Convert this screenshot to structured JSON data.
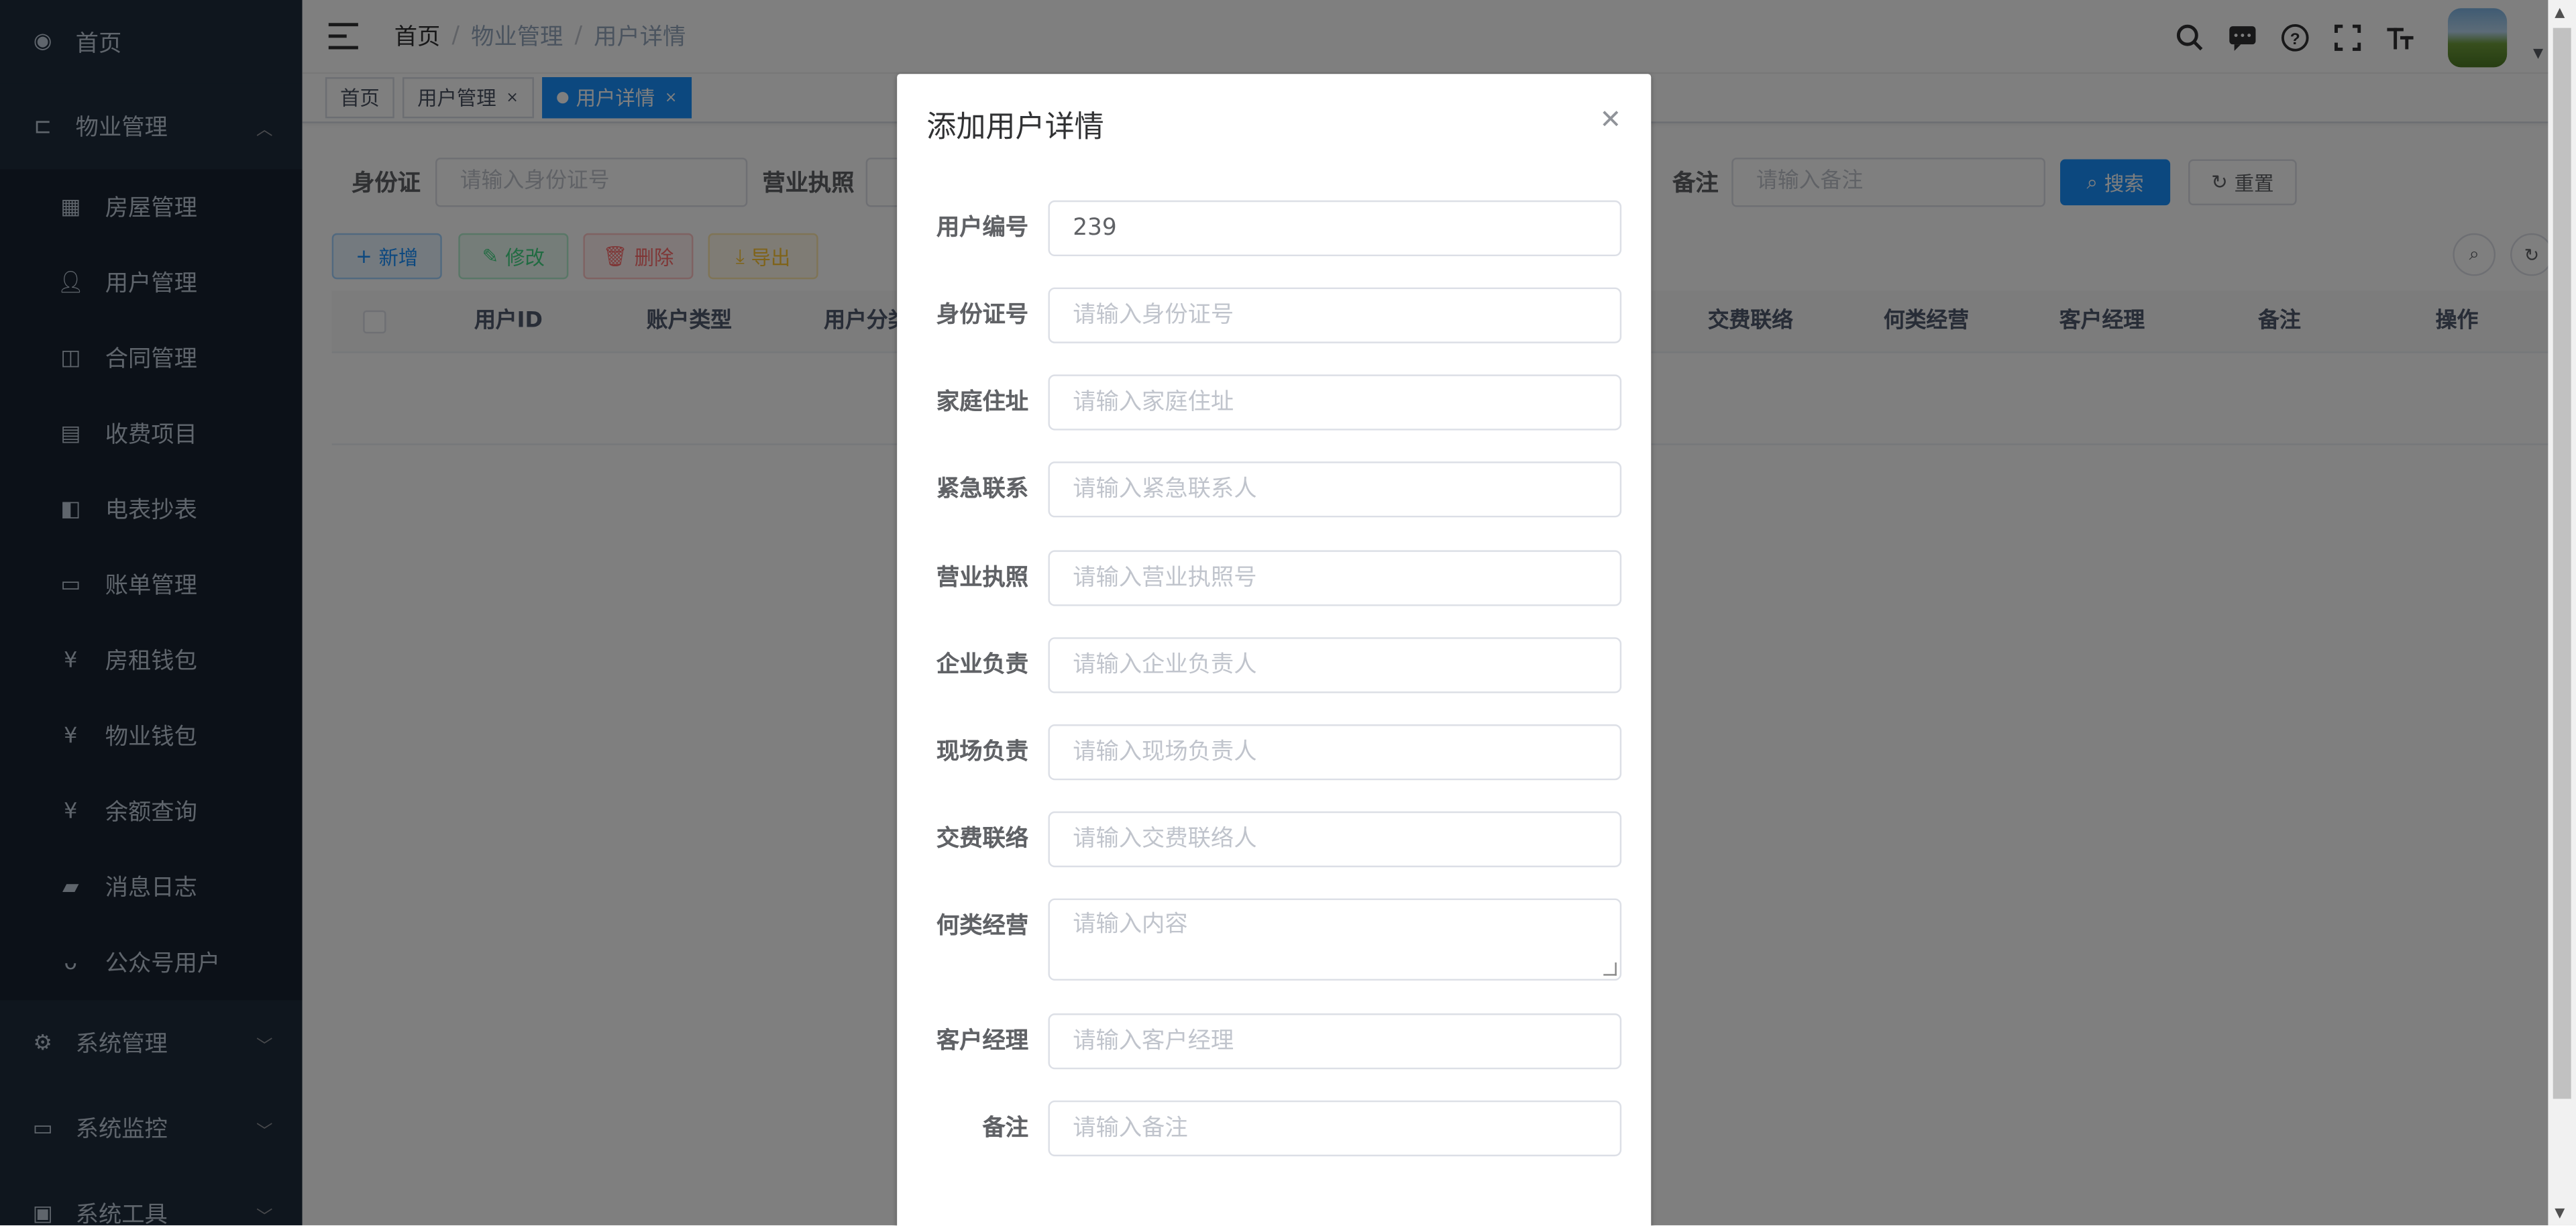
{
  "sidebar": {
    "home": "首页",
    "property_group": "物业管理",
    "items": [
      {
        "label": "房屋管理",
        "icon": "table-icon"
      },
      {
        "label": "用户管理",
        "icon": "user-icon"
      },
      {
        "label": "合同管理",
        "icon": "book-icon"
      },
      {
        "label": "收费项目",
        "icon": "chart-icon"
      },
      {
        "label": "电表抄表",
        "icon": "meter-icon"
      },
      {
        "label": "账单管理",
        "icon": "bill-icon"
      },
      {
        "label": "房租钱包",
        "icon": "yen-icon"
      },
      {
        "label": "物业钱包",
        "icon": "yen-icon"
      },
      {
        "label": "余额查询",
        "icon": "yen-icon"
      },
      {
        "label": "消息日志",
        "icon": "message-icon"
      },
      {
        "label": "公众号用户",
        "icon": "eye-icon"
      }
    ],
    "system_management": "系统管理",
    "system_monitor": "系统监控",
    "system_tools": "系统工具"
  },
  "navbar": {
    "breadcrumb": [
      "首页",
      "物业管理",
      "用户详情"
    ]
  },
  "tags": {
    "home": "首页",
    "user_mgmt": "用户管理",
    "user_detail": "用户详情"
  },
  "search": {
    "id_label": "身份证",
    "id_placeholder": "请输入身份证号",
    "license_label": "营业执照",
    "remark_label": "备注",
    "remark_placeholder": "请输入备注",
    "search_btn": "搜索",
    "reset_btn": "重置"
  },
  "toolbar": {
    "add": "新增",
    "edit": "修改",
    "delete": "删除",
    "export": "导出"
  },
  "table": {
    "columns": [
      "用户ID",
      "账户类型",
      "用户分类",
      "交费联络",
      "何类经营",
      "客户经理",
      "备注",
      "操作"
    ]
  },
  "dialog": {
    "title": "添加用户详情",
    "fields": [
      {
        "label": "用户编号",
        "value": "239",
        "placeholder": ""
      },
      {
        "label": "身份证号",
        "value": "",
        "placeholder": "请输入身份证号"
      },
      {
        "label": "家庭住址",
        "value": "",
        "placeholder": "请输入家庭住址"
      },
      {
        "label": "紧急联系",
        "value": "",
        "placeholder": "请输入紧急联系人"
      },
      {
        "label": "营业执照",
        "value": "",
        "placeholder": "请输入营业执照号"
      },
      {
        "label": "企业负责",
        "value": "",
        "placeholder": "请输入企业负责人"
      },
      {
        "label": "现场负责",
        "value": "",
        "placeholder": "请输入现场负责人"
      },
      {
        "label": "交费联络",
        "value": "",
        "placeholder": "请输入交费联络人"
      },
      {
        "label": "何类经营",
        "value": "",
        "placeholder": "请输入内容"
      },
      {
        "label": "客户经理",
        "value": "",
        "placeholder": "请输入客户经理"
      },
      {
        "label": "备注",
        "value": "",
        "placeholder": "请输入备注"
      }
    ]
  },
  "colors": {
    "sidebar_bg": "#1f2d3d",
    "primary": "#1890ff",
    "overlay": "rgba(0,0,0,0.5)"
  }
}
